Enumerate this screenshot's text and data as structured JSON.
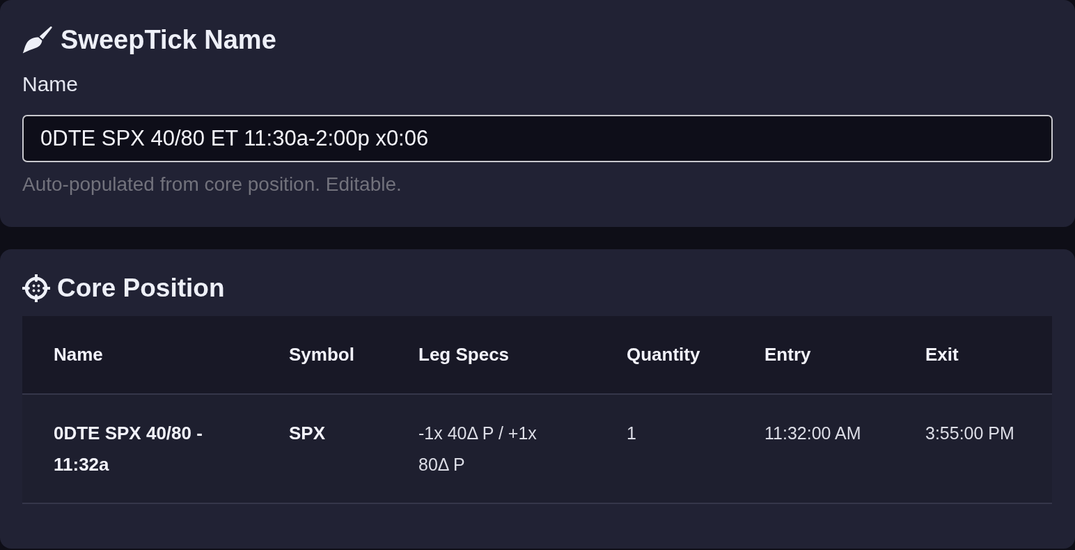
{
  "name_card": {
    "title": "SweepTick Name",
    "field_label": "Name",
    "field_value": "0DTE SPX 40/80 ET 11:30a-2:00p x0:06",
    "hint": "Auto-populated from core position. Editable."
  },
  "core_position": {
    "title": "Core Position",
    "table": {
      "columns": [
        "Name",
        "Symbol",
        "Leg Specs",
        "Quantity",
        "Entry",
        "Exit"
      ],
      "rows": [
        [
          "0DTE SPX 40/80 - 11:32a",
          "SPX",
          "-1x 40Δ P / +1x 80Δ P",
          "1",
          "11:32:00 AM",
          "3:55:00 PM"
        ]
      ]
    }
  }
}
